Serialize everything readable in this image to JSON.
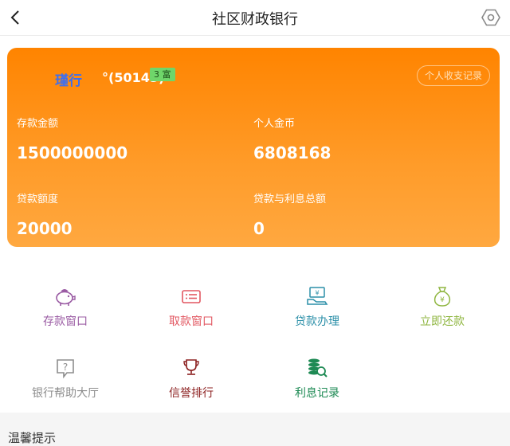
{
  "header": {
    "title": "社区财政银行"
  },
  "user": {
    "name": "瑾行",
    "id": "°(50145)",
    "badge": "3 富",
    "record_button": "个人收支记录"
  },
  "stats": {
    "deposit_label": "存款金额",
    "deposit_value": "1500000000",
    "coins_label": "个人金币",
    "coins_value": "6808168",
    "loan_limit_label": "贷款额度",
    "loan_limit_value": "20000",
    "loan_total_label": "贷款与利息总额",
    "loan_total_value": "0"
  },
  "menu": [
    {
      "label": "存款窗口",
      "color": "#9a5ba3",
      "icon": "piggy-bank-icon"
    },
    {
      "label": "取款窗口",
      "color": "#e25761",
      "icon": "wallet-card-icon"
    },
    {
      "label": "贷款办理",
      "color": "#2b8fa8",
      "icon": "loan-money-icon"
    },
    {
      "label": "立即还款",
      "color": "#8fb640",
      "icon": "money-bag-icon"
    },
    {
      "label": "银行帮助大厅",
      "color": "#8d8d8d",
      "icon": "help-icon"
    },
    {
      "label": "信誉排行",
      "color": "#8b1e1e",
      "icon": "trophy-icon"
    },
    {
      "label": "利息记录",
      "color": "#1e8a54",
      "icon": "coin-search-icon"
    }
  ],
  "tips": {
    "title": "温馨提示"
  }
}
